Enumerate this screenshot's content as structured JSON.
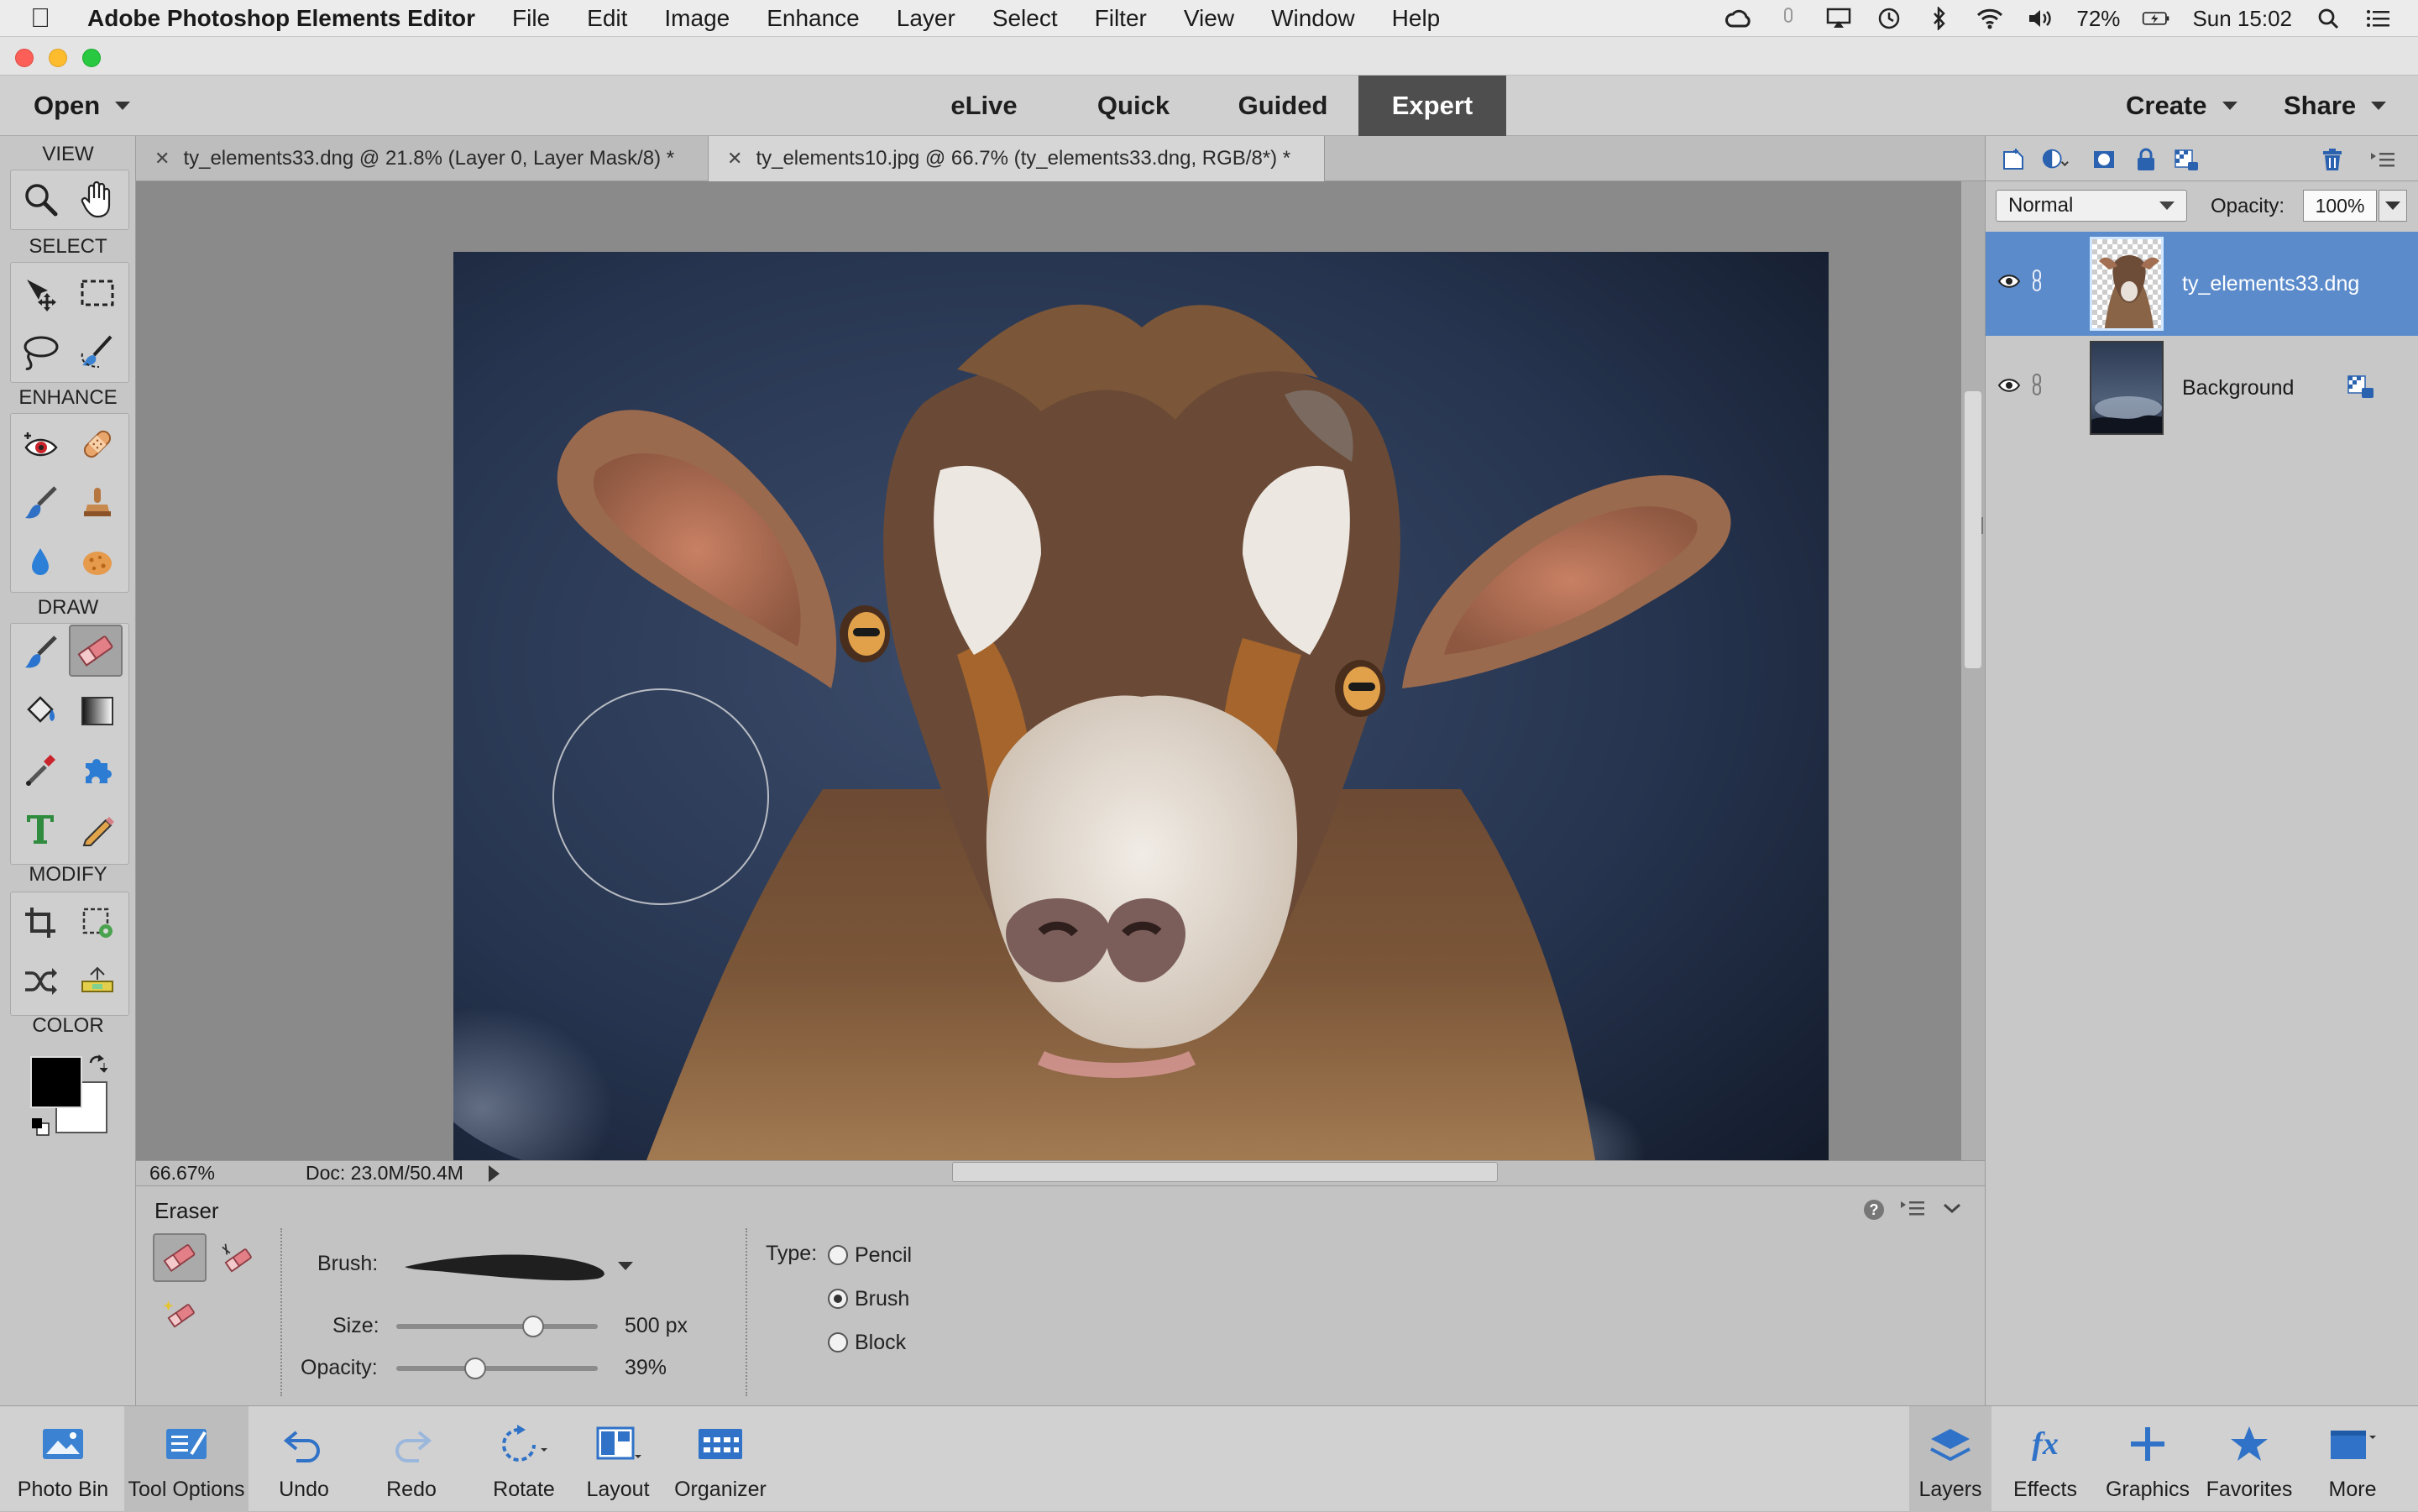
{
  "mac_menubar": {
    "app_name": "Adobe Photoshop Elements Editor",
    "menus": [
      "File",
      "Edit",
      "Image",
      "Enhance",
      "Layer",
      "Select",
      "Filter",
      "View",
      "Window",
      "Help"
    ],
    "battery": "72%",
    "clock": "Sun 15:02"
  },
  "modebar": {
    "open_label": "Open",
    "tabs": [
      "eLive",
      "Quick",
      "Guided",
      "Expert"
    ],
    "active_tab": "Expert",
    "create_label": "Create",
    "share_label": "Share"
  },
  "toolbox": {
    "sections": {
      "view": "VIEW",
      "select": "SELECT",
      "enhance": "ENHANCE",
      "draw": "DRAW",
      "modify": "MODIFY",
      "color": "COLOR"
    },
    "foreground_color": "#000000",
    "background_color": "#ffffff"
  },
  "doc_tabs": [
    {
      "label": "ty_elements33.dng @ 21.8% (Layer 0, Layer Mask/8) *",
      "active": false
    },
    {
      "label": "ty_elements10.jpg @ 66.7% (ty_elements33.dng, RGB/8*) *",
      "active": true
    }
  ],
  "status": {
    "zoom": "66.67%",
    "doc_size": "Doc: 23.0M/50.4M"
  },
  "tool_options": {
    "title": "Eraser",
    "brush_label": "Brush:",
    "size_label": "Size:",
    "size_value": "500 px",
    "size_fraction": 0.68,
    "opacity_label": "Opacity:",
    "opacity_value": "39%",
    "opacity_fraction": 0.39,
    "type_label": "Type:",
    "type_options": [
      "Pencil",
      "Brush",
      "Block"
    ],
    "type_selected": "Brush"
  },
  "layers_panel": {
    "blend_mode": "Normal",
    "opacity_label": "Opacity:",
    "opacity_value": "100%",
    "layers": [
      {
        "name": "ty_elements33.dng",
        "selected": true
      },
      {
        "name": "Background",
        "selected": false
      }
    ],
    "selection_color": "#5b8bcb"
  },
  "taskbar": {
    "left": [
      "Photo Bin",
      "Tool Options",
      "Undo",
      "Redo",
      "Rotate",
      "Layout",
      "Organizer"
    ],
    "right": [
      "Layers",
      "Effects",
      "Graphics",
      "Favorites",
      "More"
    ]
  }
}
